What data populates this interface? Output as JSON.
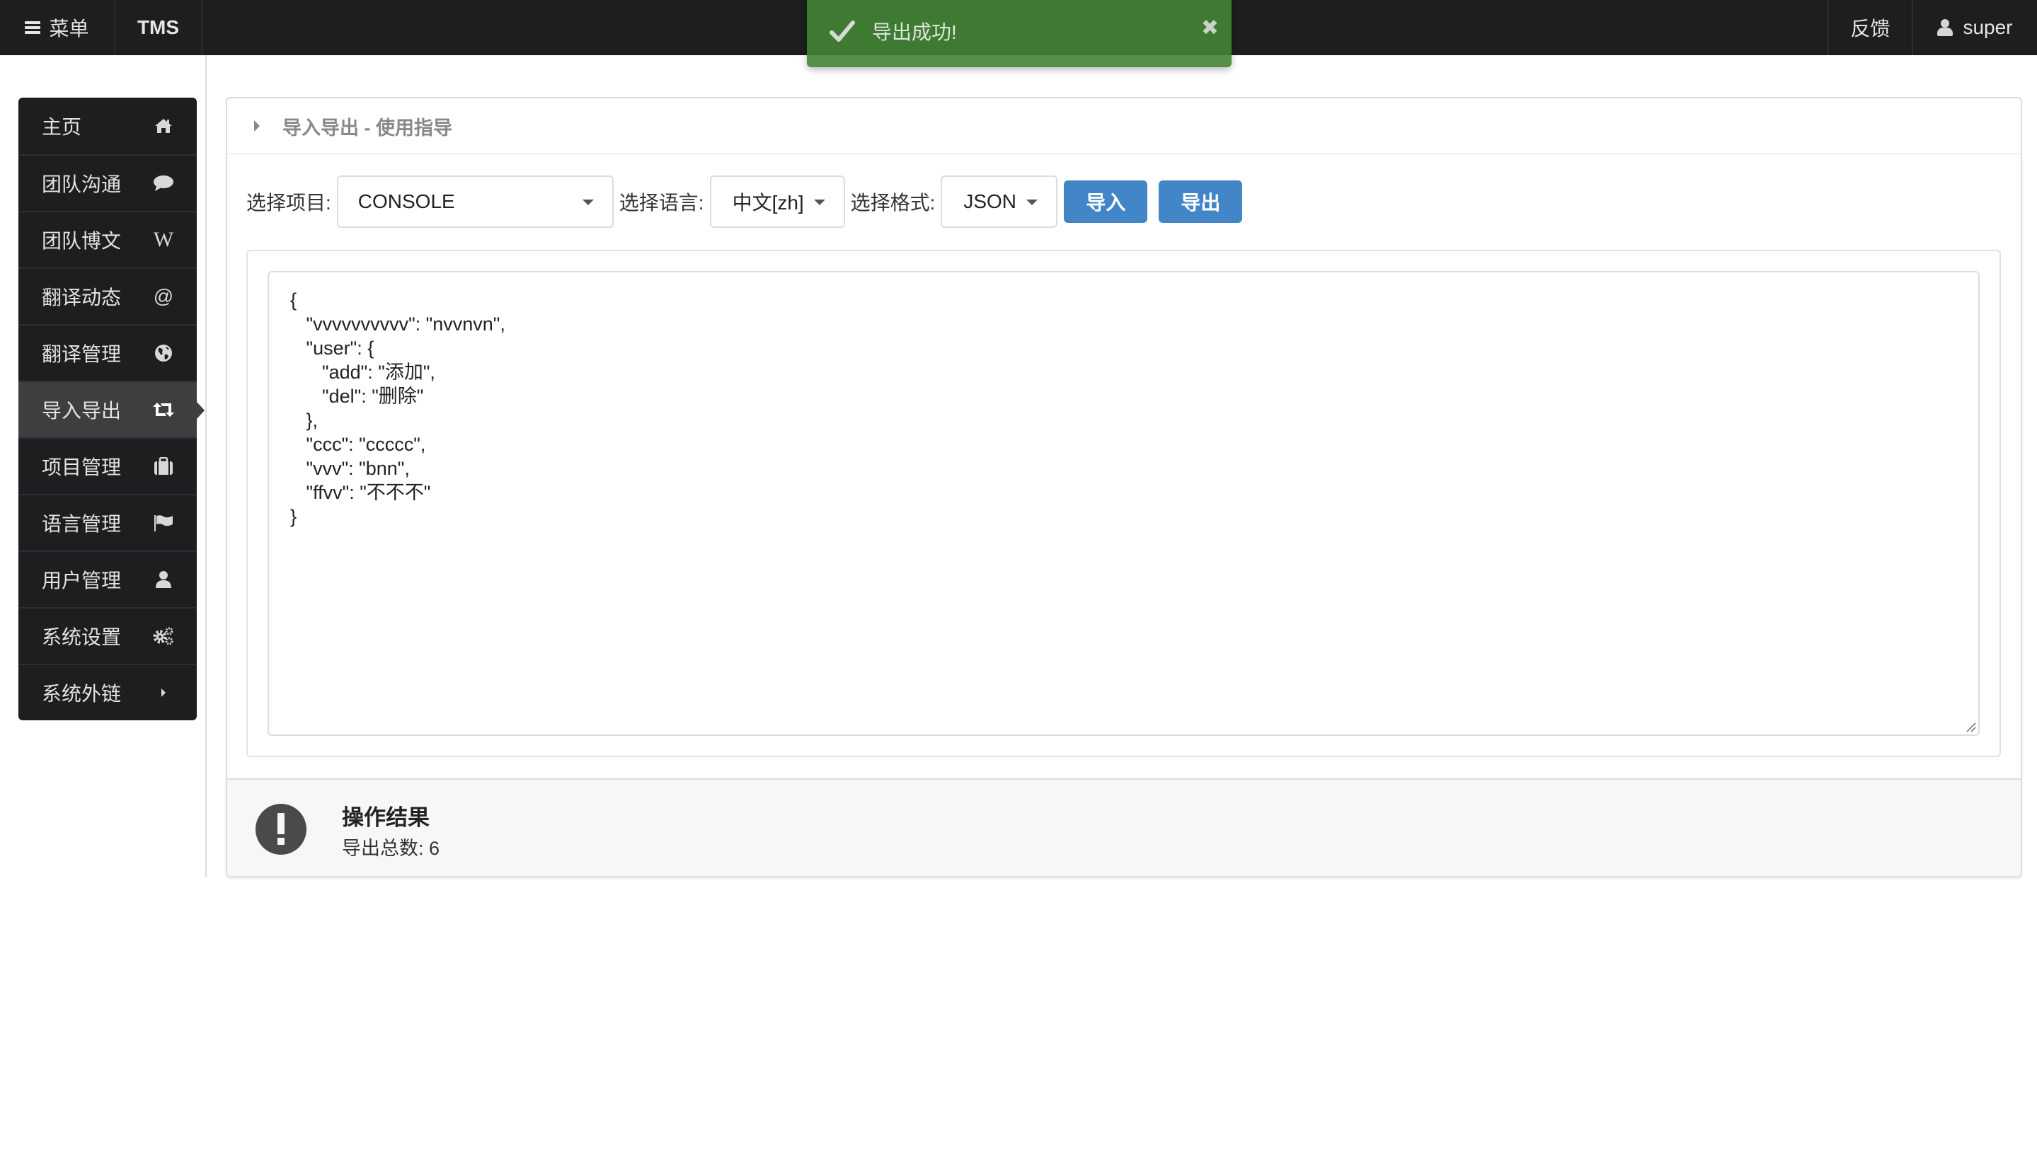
{
  "navbar": {
    "menu_label": "菜单",
    "brand": "TMS",
    "feedback_label": "反馈",
    "user_label": "super"
  },
  "toast": {
    "message": "导出成功!",
    "type": "success",
    "color": "#438434"
  },
  "sidebar": {
    "items": [
      {
        "label": "主页",
        "icon": "home-icon"
      },
      {
        "label": "团队沟通",
        "icon": "comment-icon"
      },
      {
        "label": "团队博文",
        "icon": "wikipedia-icon"
      },
      {
        "label": "翻译动态",
        "icon": "at-icon"
      },
      {
        "label": "翻译管理",
        "icon": "globe-icon"
      },
      {
        "label": "导入导出",
        "icon": "retweet-icon",
        "active": true
      },
      {
        "label": "项目管理",
        "icon": "briefcase-icon"
      },
      {
        "label": "语言管理",
        "icon": "flag-icon"
      },
      {
        "label": "用户管理",
        "icon": "user-icon"
      },
      {
        "label": "系统设置",
        "icon": "cogs-icon"
      },
      {
        "label": "系统外链",
        "icon": "caret-right-icon"
      }
    ]
  },
  "guide": {
    "title": "导入导出 - 使用指导"
  },
  "form": {
    "project_label": "选择项目:",
    "project_value": "CONSOLE",
    "language_label": "选择语言:",
    "language_value": "中文[zh]",
    "format_label": "选择格式:",
    "format_value": "JSON",
    "import_label": "导入",
    "export_label": "导出",
    "button_color": "#4286c8"
  },
  "editor": {
    "content": "{\n   \"vvvvvvvvvv\": \"nvvnvn\",\n   \"user\": {\n      \"add\": \"添加\",\n      \"del\": \"删除\"\n   },\n   \"ccc\": \"ccccc\",\n   \"vvv\": \"bnn\",\n   \"ffvv\": \"不不不\"\n}"
  },
  "result": {
    "title": "操作结果",
    "text": "导出总数: 6"
  }
}
